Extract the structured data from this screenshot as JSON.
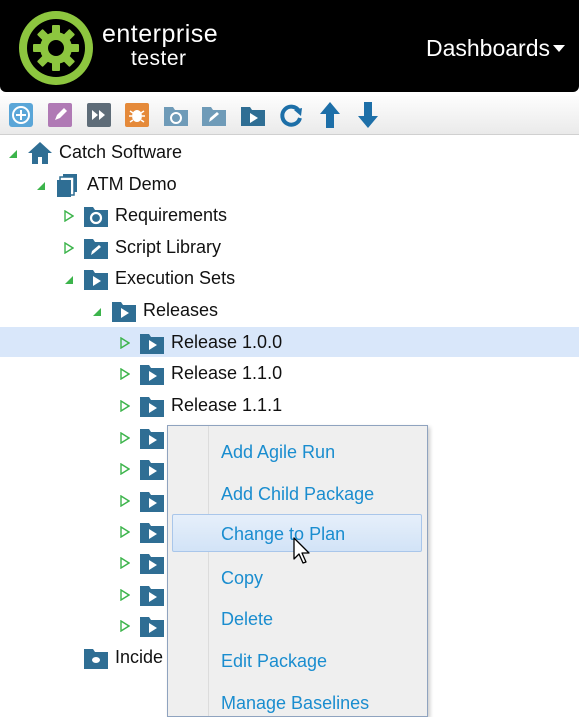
{
  "header": {
    "brand_line1": "enterprise",
    "brand_line2": "tester",
    "dashboards_label": "Dashboards"
  },
  "toolbar": {
    "buttons": [
      {
        "icon": "add-execution-icon",
        "color": "#5aa6d8"
      },
      {
        "icon": "edit-icon",
        "color": "#b07ab5"
      },
      {
        "icon": "fast-forward-icon",
        "color": "#5e6c78"
      },
      {
        "icon": "bug-icon",
        "color": "#e58a3a"
      },
      {
        "icon": "folder-camera-icon",
        "color": "#6f9bb8"
      },
      {
        "icon": "folder-edit-icon",
        "color": "#6f9bb8"
      },
      {
        "icon": "folder-play-icon",
        "color": "#2f6e94"
      },
      {
        "icon": "refresh-icon",
        "color": "#1d6fa8"
      },
      {
        "icon": "move-up-icon",
        "color": "#1d6fa8"
      },
      {
        "icon": "move-down-icon",
        "color": "#1d6fa8"
      }
    ]
  },
  "tree": {
    "nodes": [
      {
        "label": "Catch Software",
        "icon": "home-icon",
        "expanded": true
      },
      {
        "label": "ATM Demo",
        "icon": "project-icon",
        "expanded": true
      },
      {
        "label": "Requirements",
        "icon": "folder-camera-icon",
        "expanded": false
      },
      {
        "label": "Script Library",
        "icon": "folder-edit-icon",
        "expanded": false
      },
      {
        "label": "Execution Sets",
        "icon": "folder-play-icon",
        "expanded": true
      },
      {
        "label": "Releases",
        "icon": "folder-play-icon",
        "expanded": true
      },
      {
        "label": "Release 1.0.0",
        "icon": "folder-play-icon",
        "expanded": false,
        "selected": true
      },
      {
        "label": "Release 1.1.0",
        "icon": "folder-play-icon",
        "expanded": false
      },
      {
        "label": "Release 1.1.1",
        "icon": "folder-play-icon",
        "expanded": false
      },
      {
        "label": "",
        "icon": "folder-play-icon",
        "expanded": false
      },
      {
        "label": "",
        "icon": "folder-play-icon",
        "expanded": false
      },
      {
        "label": "",
        "icon": "folder-play-icon",
        "expanded": false
      },
      {
        "label": "",
        "icon": "folder-play-icon",
        "expanded": false
      },
      {
        "label": "",
        "icon": "folder-play-icon",
        "expanded": false
      },
      {
        "label": "",
        "icon": "folder-play-icon",
        "expanded": false
      },
      {
        "label": "",
        "icon": "folder-play-icon",
        "expanded": false
      },
      {
        "label": "Incide",
        "icon": "folder-bug-icon"
      }
    ]
  },
  "context_menu": {
    "items": [
      {
        "label": "Add Agile Run"
      },
      {
        "label": "Add Child Package"
      },
      {
        "label": "Change to Plan",
        "hovered": true
      },
      {
        "label": "Copy"
      },
      {
        "label": "Delete"
      },
      {
        "label": "Edit Package"
      },
      {
        "label": "Manage Baselines"
      }
    ]
  },
  "colors": {
    "brand_green": "#8dc63f",
    "link_blue": "#1a8dcf",
    "folder_blue": "#2f6e94",
    "selection": "#d9e7fa",
    "tree_arrow_green": "#3cb44b"
  }
}
